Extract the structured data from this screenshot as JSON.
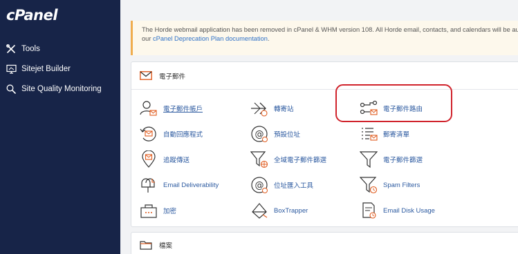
{
  "app": {
    "logo_text": "cPanel"
  },
  "sidebar": {
    "items": [
      {
        "label": "Tools",
        "icon": "tools-icon"
      },
      {
        "label": "Sitejet Builder",
        "icon": "sitejet-icon"
      },
      {
        "label": "Site Quality Monitoring",
        "icon": "search-icon"
      }
    ]
  },
  "notice": {
    "line1": "The Horde webmail application has been removed in cPanel & WHM version 108. All Horde email, contacts, and calendars will be au",
    "line2_prefix": "our ",
    "link_text": "cPanel Deprecation Plan documentation",
    "line2_suffix": "."
  },
  "email_section": {
    "title": "電子郵件",
    "tools": [
      {
        "label": "電子郵件帳戶",
        "icon": "email-accounts-icon"
      },
      {
        "label": "轉寄站",
        "icon": "forwarders-icon"
      },
      {
        "label": "電子郵件路由",
        "icon": "email-routing-icon"
      },
      {
        "label": "自動回應程式",
        "icon": "autoresponders-icon"
      },
      {
        "label": "預設位址",
        "icon": "default-address-icon"
      },
      {
        "label": "郵寄清單",
        "icon": "mailing-lists-icon"
      },
      {
        "label": "追蹤傳送",
        "icon": "track-delivery-icon"
      },
      {
        "label": "全域電子郵件篩選",
        "icon": "global-filters-icon"
      },
      {
        "label": "電子郵件篩選",
        "icon": "email-filters-icon"
      },
      {
        "label": "Email Deliverability",
        "icon": "email-deliverability-icon"
      },
      {
        "label": "位址匯入工具",
        "icon": "address-importer-icon"
      },
      {
        "label": "Spam Filters",
        "icon": "spam-filters-icon"
      },
      {
        "label": "加密",
        "icon": "encryption-icon"
      },
      {
        "label": "BoxTrapper",
        "icon": "boxtrapper-icon"
      },
      {
        "label": "Email Disk Usage",
        "icon": "email-disk-usage-icon"
      }
    ]
  },
  "files_section": {
    "title": "檔案"
  },
  "colors": {
    "sidebar_bg": "#172448",
    "link": "#2c5aa0",
    "accent_orange": "#f0ad4e",
    "highlight_red": "#d0222b"
  }
}
